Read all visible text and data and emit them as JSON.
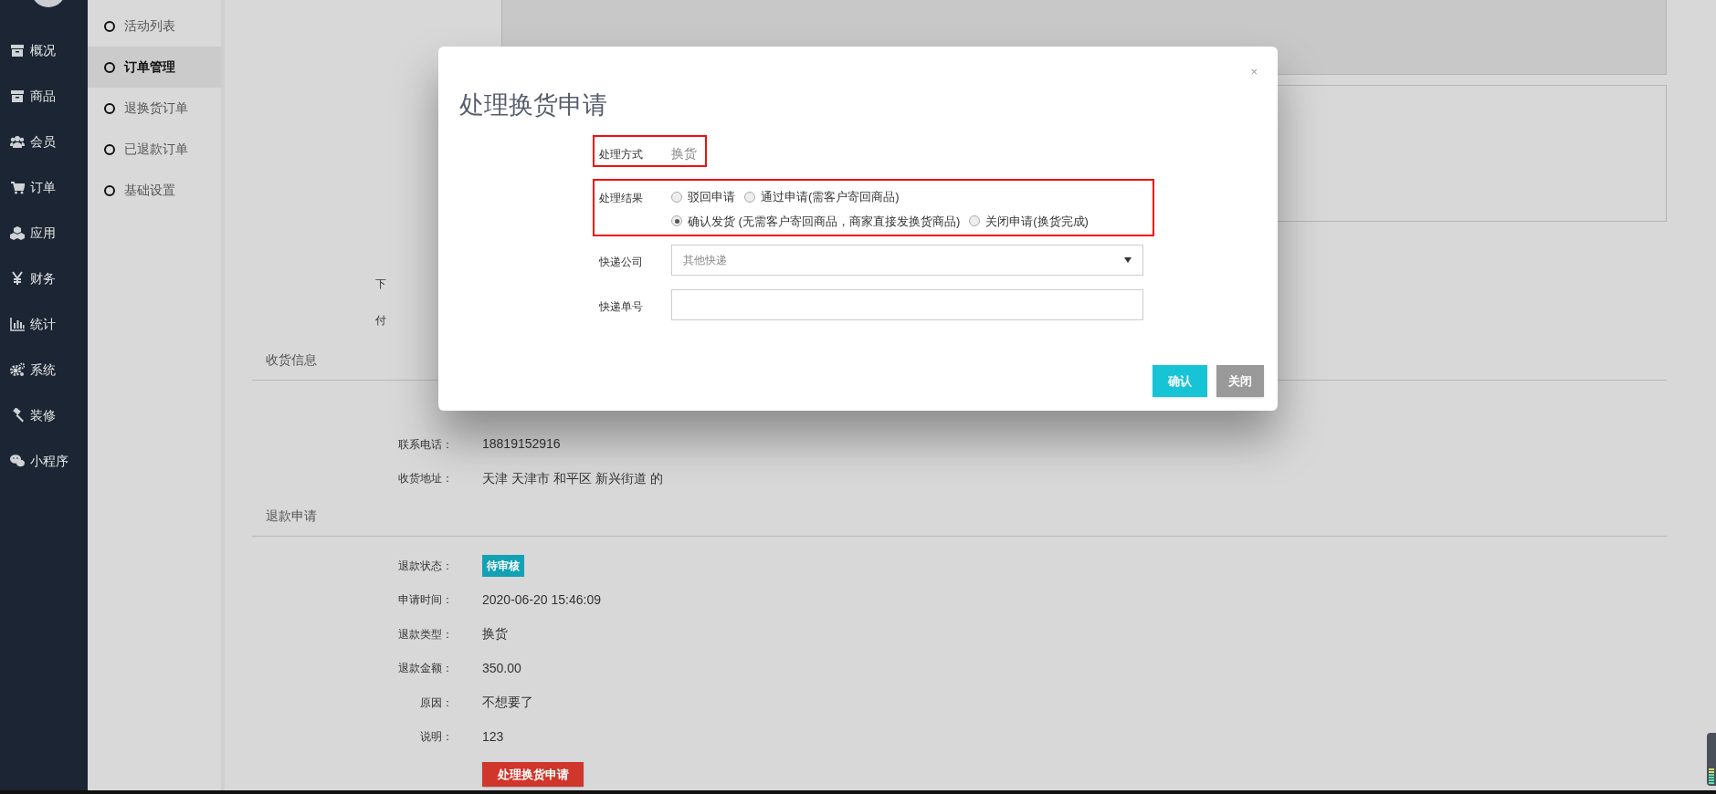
{
  "sidebar": {
    "items": [
      {
        "label": "概况"
      },
      {
        "label": "商品"
      },
      {
        "label": "会员"
      },
      {
        "label": "订单"
      },
      {
        "label": "应用"
      },
      {
        "label": "财务"
      },
      {
        "label": "统计"
      },
      {
        "label": "系统"
      },
      {
        "label": "装修"
      },
      {
        "label": "小程序"
      }
    ]
  },
  "subnav": {
    "items": [
      {
        "label": "活动列表",
        "selected": false
      },
      {
        "label": "订单管理",
        "selected": true
      },
      {
        "label": "退换货订单",
        "selected": false
      },
      {
        "label": "已退款订单",
        "selected": false
      },
      {
        "label": "基础设置",
        "selected": false
      }
    ]
  },
  "textareas": [
    {
      "disabled": true
    },
    {
      "disabled": false
    }
  ],
  "order_labels": [
    "下",
    "付"
  ],
  "sections": [
    {
      "title": "收货信息",
      "rows": [
        {
          "label": "联系电话：",
          "value": "18819152916",
          "kind": "text"
        },
        {
          "label": "收货地址：",
          "value": "天津 天津市 和平区 新兴街道 的",
          "kind": "text"
        }
      ]
    },
    {
      "title": "退款申请",
      "rows": [
        {
          "label": "退款状态：",
          "value": "待审核",
          "kind": "badge"
        },
        {
          "label": "申请时间：",
          "value": "2020-06-20 15:46:09",
          "kind": "text"
        },
        {
          "label": "退款类型：",
          "value": "换货",
          "kind": "text"
        },
        {
          "label": "退款金额：",
          "value": "350.00",
          "kind": "text"
        },
        {
          "label": "原因：",
          "value": "不想要了",
          "kind": "text"
        },
        {
          "label": "说明：",
          "value": "123",
          "kind": "text"
        }
      ]
    }
  ],
  "action_button": "处理换货申请",
  "modal": {
    "title": "处理换货申请",
    "close": "×",
    "fields": [
      {
        "kind": "text",
        "label": "处理方式",
        "value": "换货",
        "highlighted": true
      },
      {
        "kind": "radio",
        "label": "处理结果",
        "highlighted": true,
        "options": [
          {
            "label": "驳回申请",
            "selected": false
          },
          {
            "label": "通过申请(需客户寄回商品)",
            "selected": false
          },
          {
            "label": "确认发货 (无需客户寄回商品，商家直接发换货商品)",
            "selected": true
          },
          {
            "label": "关闭申请(换货完成)",
            "selected": false
          }
        ]
      },
      {
        "kind": "select",
        "label": "快递公司",
        "value": "其他快递",
        "highlighted": false
      },
      {
        "kind": "input",
        "label": "快递单号",
        "highlighted": false
      }
    ],
    "buttons": [
      {
        "label": "确认",
        "kind": "primary"
      },
      {
        "label": "关闭",
        "kind": "secondary"
      }
    ]
  }
}
